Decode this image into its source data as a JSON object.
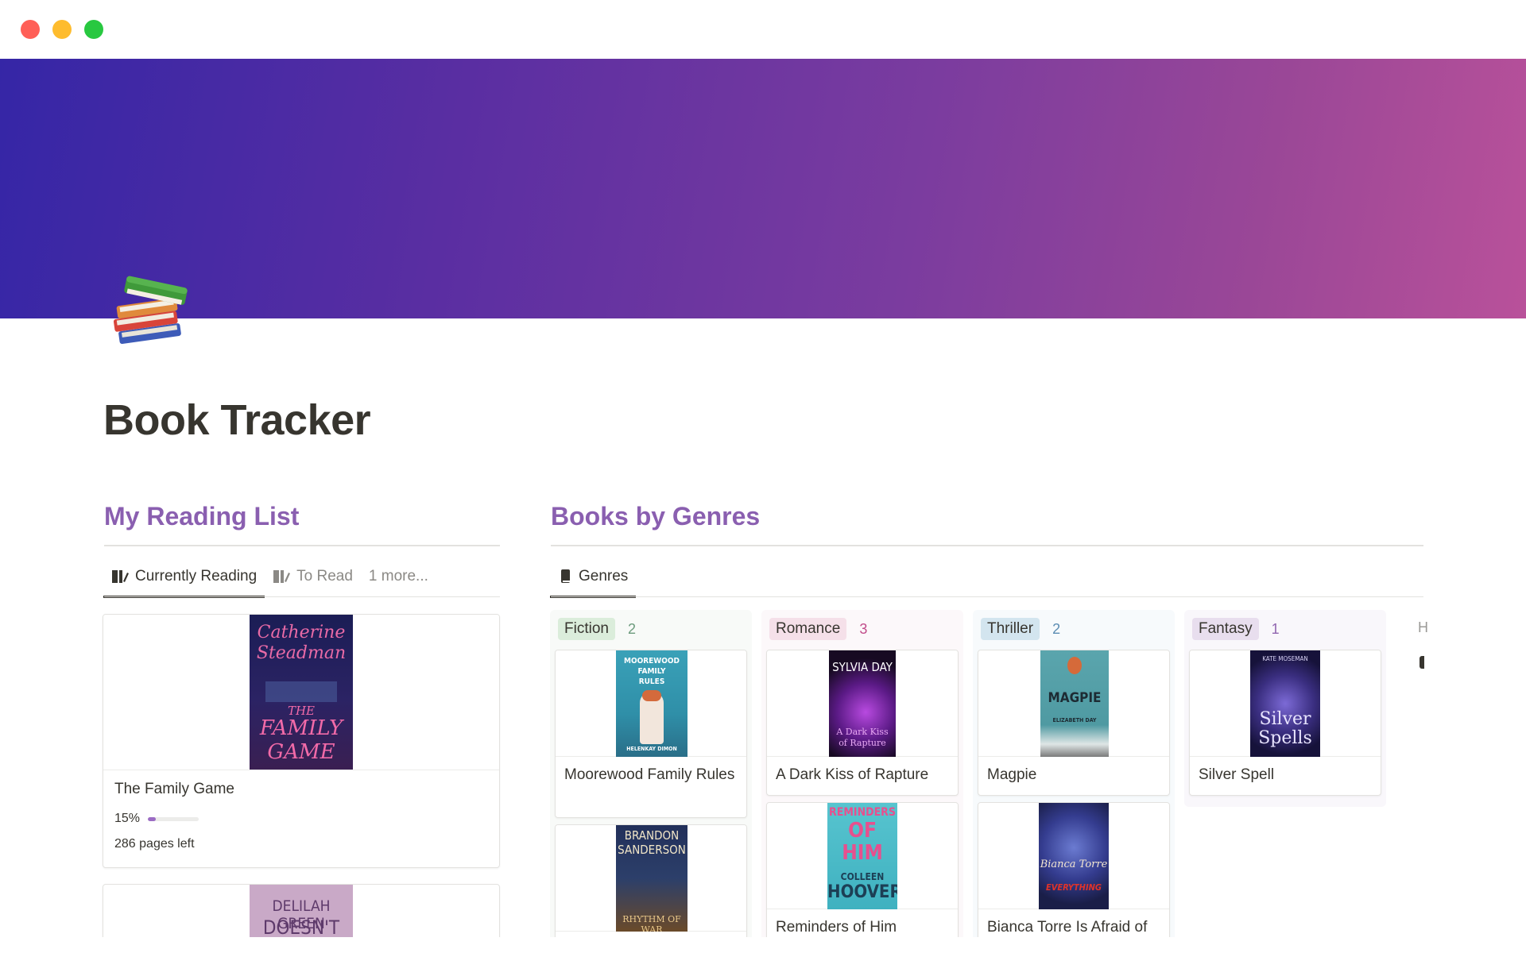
{
  "window": {
    "controls": [
      "close",
      "minimize",
      "zoom"
    ]
  },
  "page": {
    "title": "Book Tracker",
    "icon": "books-icon"
  },
  "reading_list": {
    "heading": "My Reading List",
    "tabs": [
      {
        "label": "Currently Reading",
        "icon": "book-open-icon",
        "active": true
      },
      {
        "label": "To Read",
        "icon": "book-open-icon",
        "active": false
      },
      {
        "label": "1 more...",
        "active": false
      }
    ],
    "cards": [
      {
        "title": "The Family Game",
        "progress_label": "15%",
        "progress": 0.15,
        "pages_left": "286 pages left",
        "cover": {
          "line1": "Catherine",
          "line2": "Steadman",
          "line3": "THE",
          "line4": "FAMILY",
          "line5": "GAME"
        }
      },
      {
        "title": "",
        "cover": {
          "line1": "DELILAH GREEN",
          "line2": "DOESN'T CARE"
        }
      }
    ]
  },
  "genres": {
    "heading": "Books by Genres",
    "tab": {
      "label": "Genres",
      "icon": "book-icon"
    },
    "columns": [
      {
        "tag": "Fiction",
        "count": "2",
        "tag_bg": "#dbeddb",
        "col_bg": "#f8faf8",
        "count_color": "#6c9b7d",
        "books": [
          {
            "title": "Moorewood Family Rules",
            "cover": {
              "line1": "MOOREWOOD",
              "line2": "FAMILY",
              "line3": "RULES",
              "line4": "HELENKAY DIMON"
            }
          },
          {
            "title": "",
            "cover": {
              "line1": "BRANDON",
              "line2": "SANDERSON",
              "line3": "RHYTHM OF WAR"
            }
          }
        ]
      },
      {
        "tag": "Romance",
        "count": "3",
        "tag_bg": "#f5e0e9",
        "col_bg": "#fcf8fa",
        "count_color": "#c14c8a",
        "books": [
          {
            "title": "A Dark Kiss of Rapture",
            "cover": {
              "line1": "SYLVIA DAY",
              "line2": "A Dark Kiss",
              "line3": "of Rapture"
            }
          },
          {
            "title": "Reminders of Him",
            "cover": {
              "line1": "REMINDERS",
              "line2": "OF",
              "line3": "HIM",
              "line4": "COLLEEN",
              "line5": "HOOVER"
            }
          }
        ]
      },
      {
        "tag": "Thriller",
        "count": "2",
        "tag_bg": "#d3e5ef",
        "col_bg": "#f7fafc",
        "count_color": "#5b8db3",
        "books": [
          {
            "title": "Magpie",
            "cover": {
              "line1": "MAGPIE",
              "line2": "ELIZABETH DAY"
            }
          },
          {
            "title": "Bianca Torre Is Afraid of",
            "cover": {
              "line1": "Bianca Torre",
              "line2": "EVERYTHING"
            }
          }
        ]
      },
      {
        "tag": "Fantasy",
        "count": "1",
        "tag_bg": "#e8deee",
        "col_bg": "#f9f7fb",
        "count_color": "#9065b0",
        "books": [
          {
            "title": "Silver Spell",
            "cover": {
              "line1": "KATE MOSEMAN",
              "line2": "Silver",
              "line3": "Spells"
            }
          }
        ]
      }
    ],
    "overflow_column_letter": "H"
  }
}
